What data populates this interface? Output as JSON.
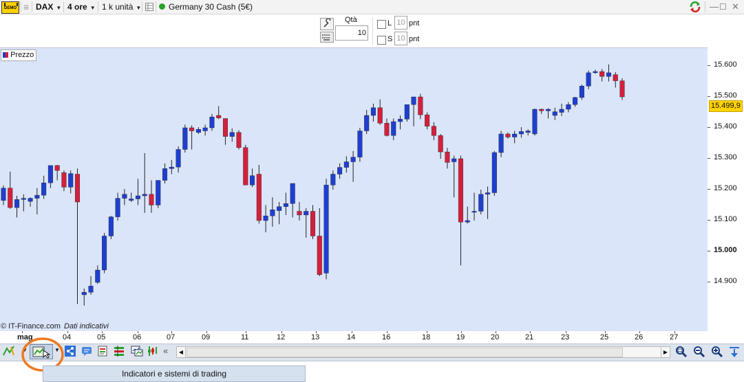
{
  "toolbar": {
    "demo_label": "DEMO",
    "instrument": "DAX",
    "timeframe": "4 ore",
    "units": "1 k unità",
    "market": "Germany 30 Cash (5€)"
  },
  "order": {
    "qty_label": "Qtà",
    "qty_value": "10",
    "l_label": "L",
    "l_value": "10",
    "s_label": "S",
    "s_value": "10",
    "unit": "pnt"
  },
  "chart_header": {
    "label": "Prezzo"
  },
  "footer": {
    "copyright": "© IT-Finance.com",
    "note": "Dati indicativi"
  },
  "tooltip": "Indicatori e sistemi di trading",
  "scroll_left": "«",
  "colors": {
    "up": "#1f3fd0",
    "down": "#d4203c",
    "bg": "#dae5f9",
    "price_badge": "#ffd200"
  },
  "chart_data": {
    "type": "candlestick",
    "ylim": [
      14790,
      15650
    ],
    "yticks": [
      "15.600",
      "15.500",
      "15.400",
      "15.300",
      "15.200",
      "15.100",
      "15.000",
      "14.900"
    ],
    "last_price": "15.499,9",
    "x_labels": [
      "mag",
      "04",
      "05",
      "06",
      "07",
      "09",
      "11",
      "12",
      "13",
      "14",
      "16",
      "18",
      "19",
      "20",
      "21",
      "23",
      "25",
      "26",
      "27"
    ],
    "candles": [
      [
        15165,
        15214,
        15150,
        15205
      ],
      [
        15205,
        15258,
        15138,
        15142
      ],
      [
        15142,
        15180,
        15110,
        15168
      ],
      [
        15168,
        15185,
        15130,
        15172
      ],
      [
        15162,
        15175,
        15145,
        15172
      ],
      [
        15172,
        15205,
        15120,
        15182
      ],
      [
        15182,
        15245,
        15170,
        15222
      ],
      [
        15222,
        15275,
        15205,
        15278
      ],
      [
        15278,
        15280,
        15230,
        15262
      ],
      [
        15255,
        15262,
        15195,
        15208
      ],
      [
        15208,
        15262,
        15188,
        15252
      ],
      [
        15250,
        15268,
        14830,
        15160
      ],
      [
        14860,
        14880,
        14825,
        14868
      ],
      [
        14868,
        14920,
        14860,
        14888
      ],
      [
        14900,
        14955,
        14895,
        14940
      ],
      [
        14940,
        15060,
        14930,
        15050
      ],
      [
        15050,
        15115,
        15040,
        15112
      ],
      [
        15112,
        15190,
        15100,
        15172
      ],
      [
        15172,
        15202,
        15150,
        15185
      ],
      [
        15165,
        15190,
        15160,
        15170
      ],
      [
        15170,
        15235,
        15150,
        15180
      ],
      [
        15180,
        15318,
        15125,
        15185
      ],
      [
        15185,
        15230,
        15125,
        15150
      ],
      [
        15150,
        15220,
        15140,
        15230
      ],
      [
        15230,
        15285,
        15220,
        15268
      ],
      [
        15268,
        15296,
        15250,
        15273
      ],
      [
        15273,
        15340,
        15255,
        15330
      ],
      [
        15330,
        15410,
        15320,
        15400
      ],
      [
        15400,
        15408,
        15330,
        15390
      ],
      [
        15385,
        15402,
        15380,
        15395
      ],
      [
        15390,
        15410,
        15375,
        15400
      ],
      [
        15400,
        15445,
        15390,
        15435
      ],
      [
        15440,
        15470,
        15428,
        15432
      ],
      [
        15430,
        15430,
        15345,
        15372
      ],
      [
        15372,
        15398,
        15355,
        15385
      ],
      [
        15385,
        15392,
        15330,
        15336
      ],
      [
        15336,
        15345,
        15218,
        15215
      ],
      [
        15215,
        15268,
        15208,
        15245
      ],
      [
        15250,
        15280,
        15090,
        15100
      ],
      [
        15100,
        15150,
        15062,
        15115
      ],
      [
        15115,
        15175,
        15080,
        15135
      ],
      [
        15132,
        15160,
        15088,
        15145
      ],
      [
        15145,
        15190,
        15118,
        15155
      ],
      [
        15155,
        15220,
        15110,
        15220
      ],
      [
        15130,
        15160,
        15100,
        15118
      ],
      [
        15118,
        15140,
        15045,
        15130
      ],
      [
        15130,
        15150,
        15040,
        15050
      ],
      [
        15050,
        15140,
        14920,
        14925
      ],
      [
        14930,
        15235,
        14910,
        15215
      ],
      [
        15215,
        15262,
        15200,
        15250
      ],
      [
        15250,
        15285,
        15235,
        15272
      ],
      [
        15272,
        15308,
        15255,
        15290
      ],
      [
        15290,
        15325,
        15225,
        15305
      ],
      [
        15305,
        15400,
        15290,
        15390
      ],
      [
        15390,
        15458,
        15380,
        15440
      ],
      [
        15440,
        15478,
        15420,
        15465
      ],
      [
        15465,
        15492,
        15410,
        15415
      ],
      [
        15415,
        15430,
        15372,
        15375
      ],
      [
        15375,
        15430,
        15360,
        15420
      ],
      [
        15420,
        15440,
        15395,
        15428
      ],
      [
        15428,
        15470,
        15420,
        15475
      ],
      [
        15475,
        15500,
        15405,
        15500
      ],
      [
        15500,
        15510,
        15428,
        15442
      ],
      [
        15442,
        15450,
        15395,
        15405
      ],
      [
        15405,
        15418,
        15360,
        15375
      ],
      [
        15375,
        15380,
        15300,
        15322
      ],
      [
        15322,
        15335,
        15268,
        15288
      ],
      [
        15290,
        15310,
        15175,
        15300
      ],
      [
        15300,
        15310,
        14955,
        15095
      ],
      [
        15095,
        15145,
        15090,
        15100
      ],
      [
        15128,
        15190,
        15100,
        15130
      ],
      [
        15130,
        15200,
        15120,
        15185
      ],
      [
        15185,
        15210,
        15105,
        15190
      ],
      [
        15190,
        15325,
        15180,
        15320
      ],
      [
        15320,
        15390,
        15305,
        15380
      ],
      [
        15380,
        15385,
        15365,
        15370
      ],
      [
        15370,
        15390,
        15350,
        15380
      ],
      [
        15380,
        15402,
        15368,
        15388
      ],
      [
        15385,
        15395,
        15375,
        15390
      ],
      [
        15380,
        15462,
        15375,
        15460
      ],
      [
        15460,
        15462,
        15445,
        15455
      ],
      [
        15455,
        15463,
        15430,
        15460
      ],
      [
        15440,
        15465,
        15425,
        15452
      ],
      [
        15450,
        15478,
        15438,
        15460
      ],
      [
        15460,
        15483,
        15450,
        15475
      ],
      [
        15475,
        15500,
        15468,
        15498
      ],
      [
        15498,
        15540,
        15490,
        15535
      ],
      [
        15535,
        15585,
        15525,
        15578
      ],
      [
        15578,
        15588,
        15575,
        15582
      ],
      [
        15582,
        15590,
        15550,
        15566
      ],
      [
        15566,
        15605,
        15550,
        15578
      ],
      [
        15572,
        15580,
        15530,
        15552
      ],
      [
        15552,
        15560,
        15490,
        15500
      ]
    ]
  }
}
